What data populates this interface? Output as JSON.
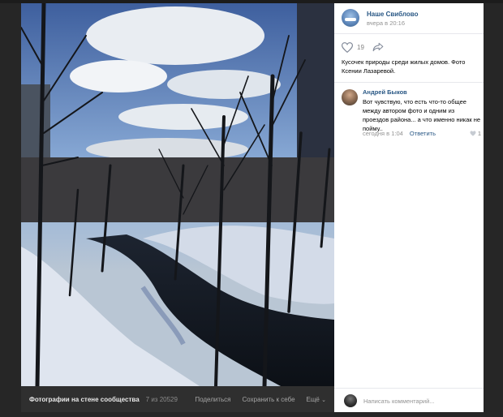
{
  "photo": {
    "album_label": "Фотографии на стене сообщества",
    "counter": "7 из 20529",
    "actions": {
      "share": "Поделиться",
      "save": "Сохранить к себе",
      "more": "Ещё",
      "more_icon": "chevron-down"
    }
  },
  "post": {
    "group_name": "Наше Свиблово",
    "time": "вчера в 20:16",
    "likes": "19",
    "caption": "Кусочек природы среди жилых домов. Фото Ксении Лазаревой."
  },
  "comments": [
    {
      "author": "Андрей Быков",
      "text": "Вот чувствую, что есть что-то общее между автором фото и одним из проездов района... а что именно никак не пойму..",
      "time": "сегодня в 1:04",
      "reply": "Ответить",
      "likes": "1"
    }
  ],
  "comment_input": {
    "placeholder": "Написать комментарий..."
  },
  "colors": {
    "link": "#2a5885",
    "muted": "#939393",
    "backdrop": "#262626"
  }
}
